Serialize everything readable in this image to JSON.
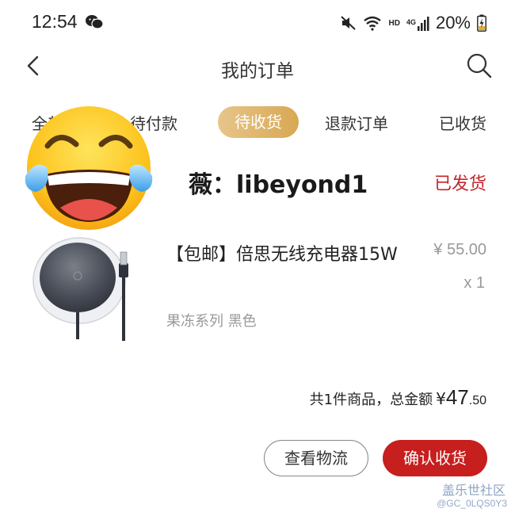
{
  "status_bar": {
    "time": "12:54",
    "battery_percent": "20%",
    "network_label": "HD",
    "cellular_label": "4G"
  },
  "header": {
    "title": "我的订单"
  },
  "tabs": {
    "items": [
      {
        "label": "全部"
      },
      {
        "label": "待付款"
      },
      {
        "label": "待收货",
        "active": true
      },
      {
        "label": "退款订单"
      },
      {
        "label": "已收货"
      }
    ]
  },
  "order": {
    "store_name": "薇：libeyond1",
    "status": "已发货",
    "product": {
      "name": "【包邮】倍思无线充电器15W",
      "price": "¥ 55.00",
      "quantity": "x 1",
      "spec": "果冻系列 黑色"
    },
    "total": {
      "label": "共1件商品，总金额",
      "currency": "¥",
      "amount_int": "47",
      "amount_dec": ".50"
    },
    "buttons": {
      "logistics": "查看物流",
      "confirm": "确认收货"
    }
  },
  "watermark": {
    "line1": "盖乐世社区",
    "line2": "@GC_0LQS0Y3"
  },
  "colors": {
    "accent_red": "#c71e1e",
    "tab_gold": "#d8a853",
    "status_red": "#c0272d"
  }
}
